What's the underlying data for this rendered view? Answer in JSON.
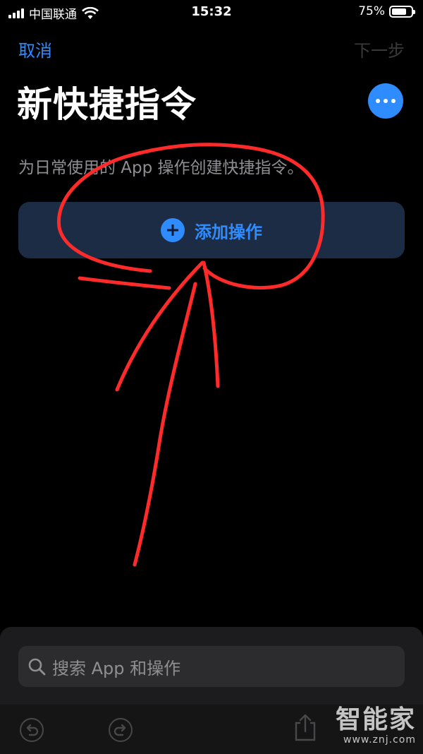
{
  "status_bar": {
    "carrier": "中国联通",
    "time": "15:32",
    "battery_percent": "75%",
    "battery_level": 0.75
  },
  "nav": {
    "cancel_label": "取消",
    "next_label": "下一步"
  },
  "page": {
    "title": "新快捷指令",
    "subtitle": "为日常使用的 App 操作创建快捷指令。"
  },
  "add_action": {
    "label": "添加操作"
  },
  "search": {
    "placeholder": "搜索 App 和操作"
  },
  "toolbar": {
    "icons": [
      "undo-icon",
      "redo-icon",
      "share-icon"
    ]
  },
  "watermark": {
    "brand": "智能家",
    "domain": "www.znj.com"
  },
  "colors": {
    "accent": "#2f8cff",
    "annotation": "#ff2a2a",
    "background": "#000000"
  }
}
